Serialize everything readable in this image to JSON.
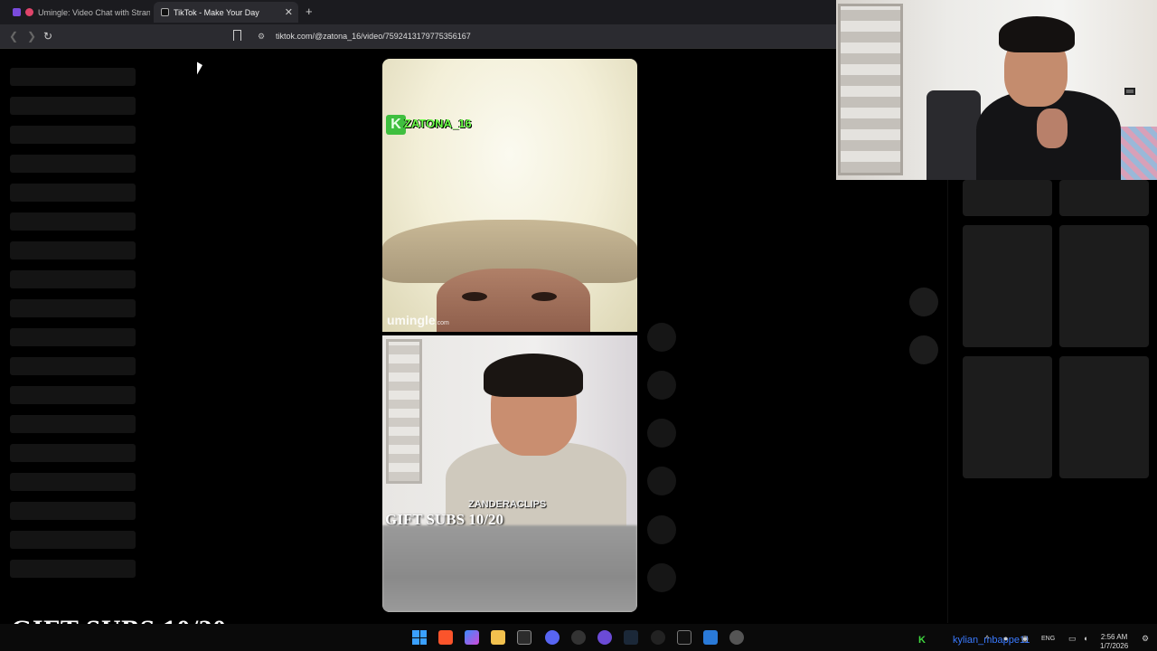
{
  "browser": {
    "tabs": [
      {
        "label": "Umingle: Video Chat with Strangers",
        "active": false
      },
      {
        "label": "TikTok - Make Your Day",
        "active": true
      }
    ],
    "url": "tiktok.com/@zatona_16/video/7592413179775356167"
  },
  "video": {
    "streamer_name": "ZATONA_16",
    "badge_letter": "K",
    "watermark": "umingle",
    "watermark_suffix": ".com",
    "clip_tag": "ZANDERACLIPS",
    "subs_overlay": "GIFT SUBS 10/20"
  },
  "stream_overlay": {
    "gift_subs": "GIFT SUBS 10/20"
  },
  "taskbar": {
    "username": "kylian_mbappe11",
    "k_badge": "K",
    "language": "ENG",
    "time": "2:56 AM",
    "date": "1/7/2026"
  },
  "colors": {
    "accent_green": "#6dff4a",
    "taskbar_user": "#3a7aff",
    "windows_blue": "#3aa0ff"
  }
}
